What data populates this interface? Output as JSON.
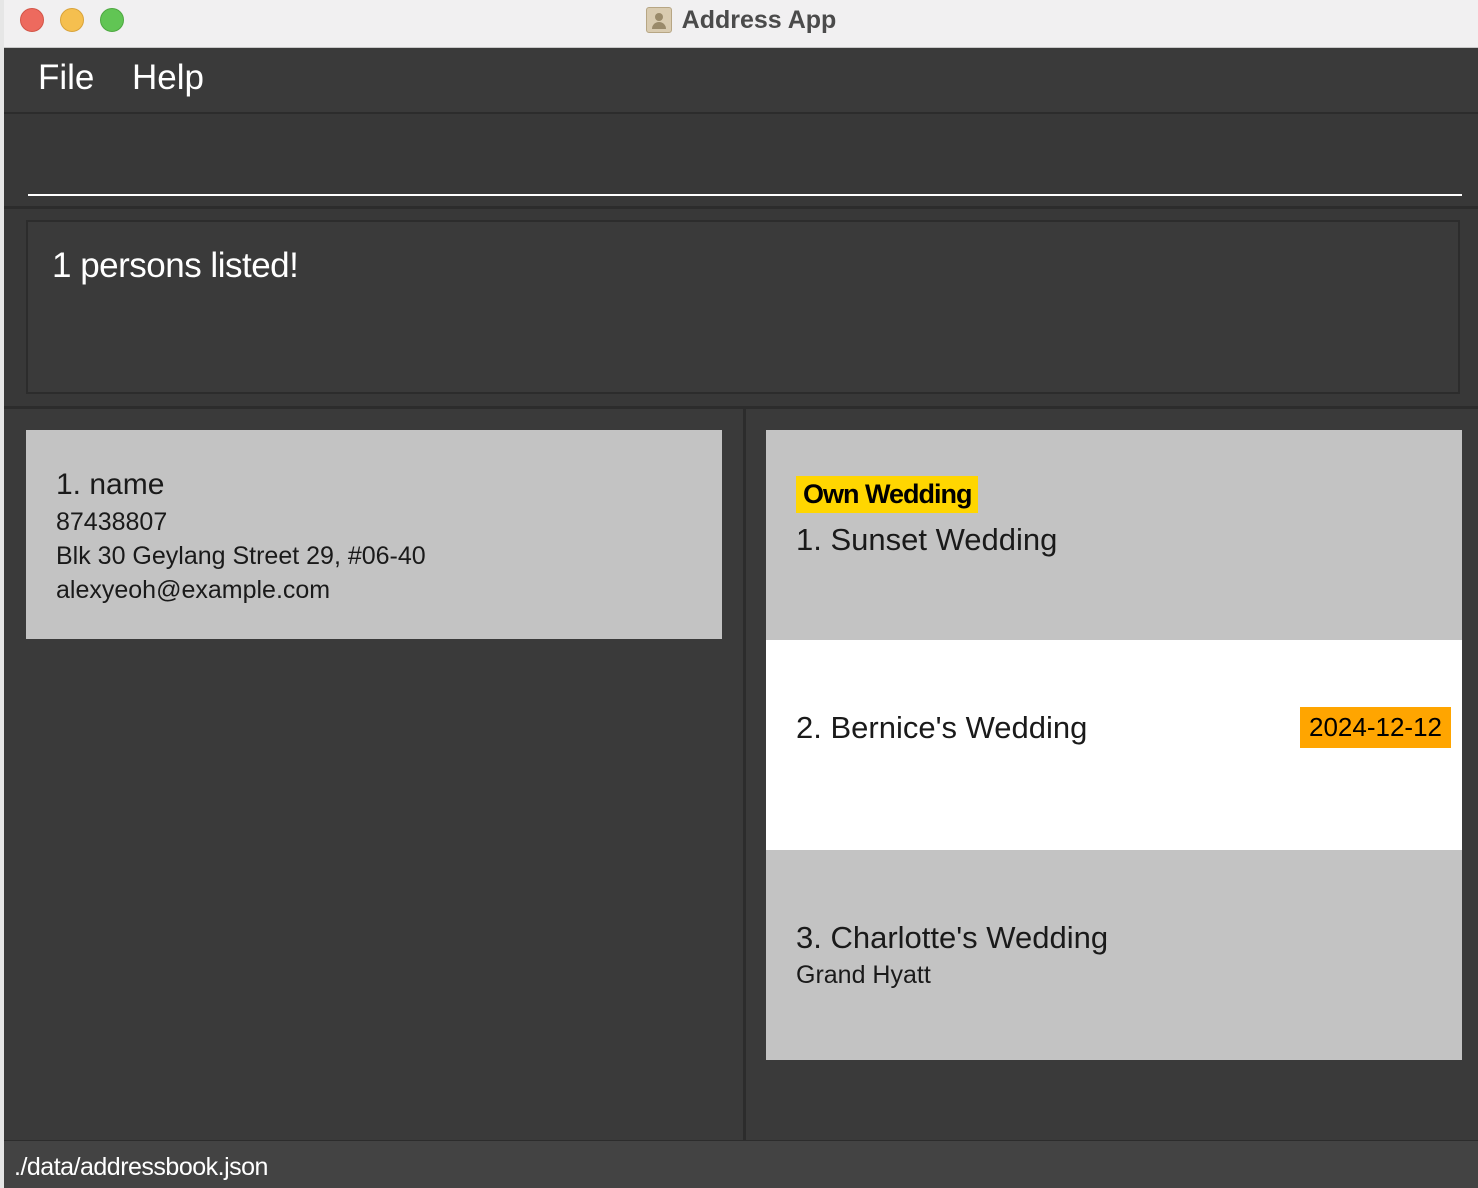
{
  "window": {
    "title": "Address App"
  },
  "menu": {
    "file": "File",
    "help": "Help"
  },
  "command": {
    "value": "",
    "placeholder": ""
  },
  "result": {
    "text": "1 persons listed!"
  },
  "persons": [
    {
      "name": "1. name",
      "phone": "87438807",
      "address": "Blk 30 Geylang Street 29, #06-40",
      "email": "alexyeoh@example.com"
    }
  ],
  "weddings": [
    {
      "tag": "Own Wedding",
      "name": "1. Sunset Wedding"
    },
    {
      "name": "2. Bernice's Wedding",
      "date": "2024-12-12"
    },
    {
      "name": "3. Charlotte's Wedding",
      "venue": "Grand Hyatt"
    }
  ],
  "status": {
    "path": "./data/addressbook.json"
  },
  "colors": {
    "background": "#3a3a3a",
    "card": "#c3c3c3",
    "selected_card": "#ffffff",
    "own_wedding_tag": "#ffd600",
    "date_badge": "#ffa500"
  },
  "icons": {
    "app": "address-book-icon"
  }
}
